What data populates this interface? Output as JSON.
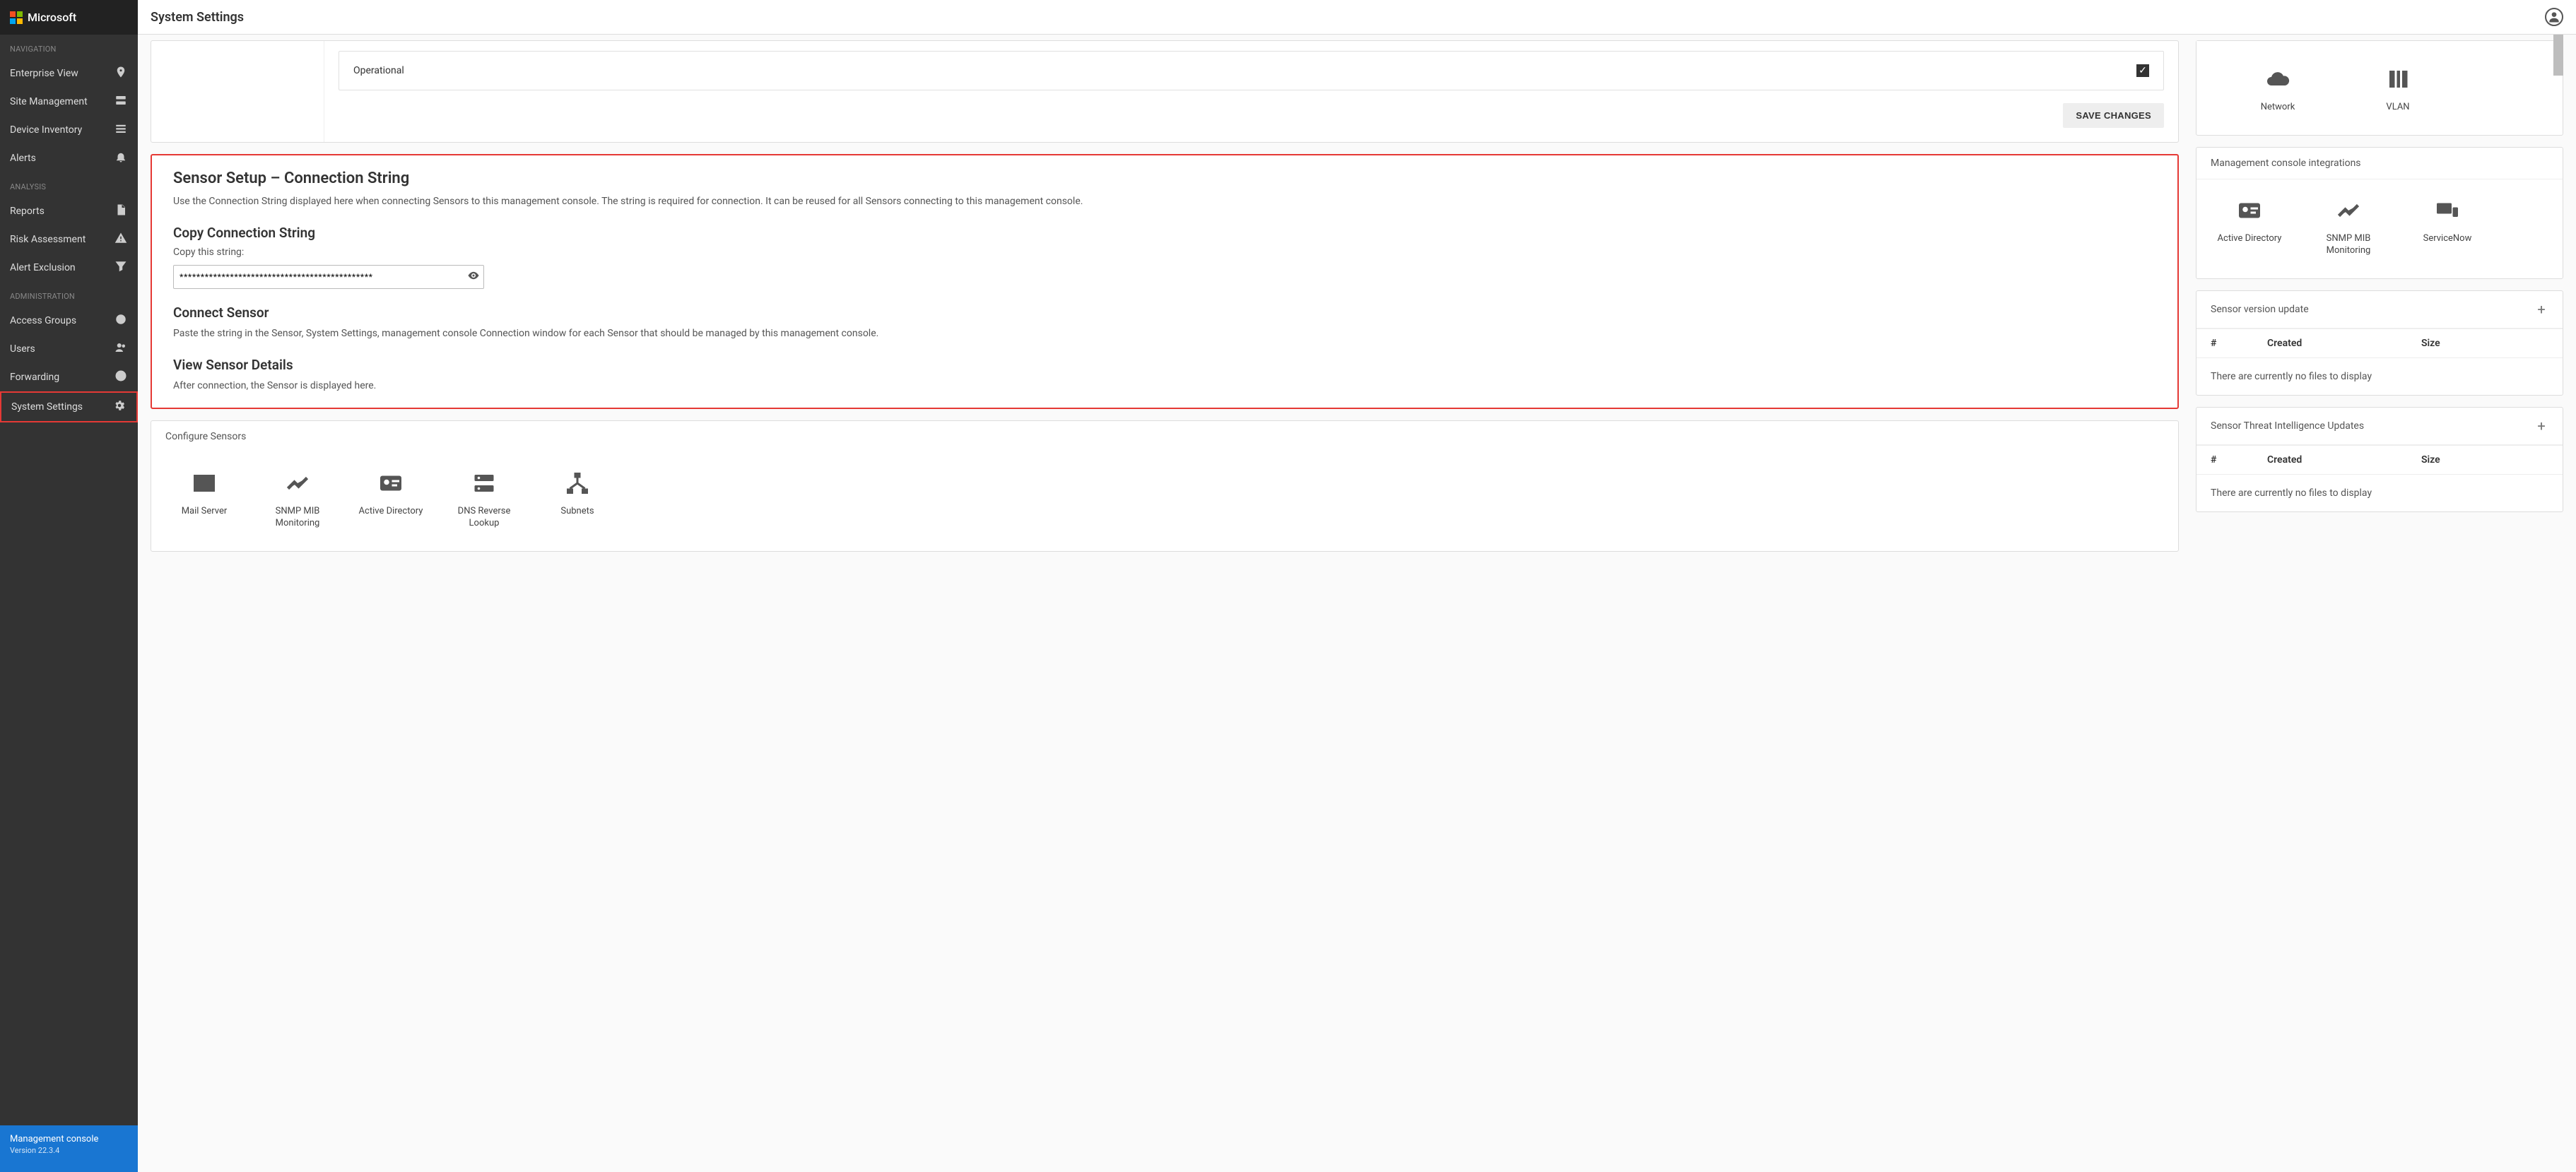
{
  "brand": {
    "name": "Microsoft"
  },
  "topbar": {
    "title": "System Settings"
  },
  "sidebar": {
    "sections": [
      {
        "label": "NAVIGATION",
        "items": [
          {
            "id": "enterprise-view",
            "label": "Enterprise View"
          },
          {
            "id": "site-management",
            "label": "Site Management"
          },
          {
            "id": "device-inventory",
            "label": "Device Inventory"
          },
          {
            "id": "alerts",
            "label": "Alerts"
          }
        ]
      },
      {
        "label": "ANALYSIS",
        "items": [
          {
            "id": "reports",
            "label": "Reports"
          },
          {
            "id": "risk-assessment",
            "label": "Risk Assessment"
          },
          {
            "id": "alert-exclusion",
            "label": "Alert Exclusion"
          }
        ]
      },
      {
        "label": "ADMINISTRATION",
        "items": [
          {
            "id": "access-groups",
            "label": "Access Groups"
          },
          {
            "id": "users",
            "label": "Users"
          },
          {
            "id": "forwarding",
            "label": "Forwarding"
          },
          {
            "id": "system-settings",
            "label": "System Settings",
            "active": true
          }
        ]
      }
    ],
    "footer": {
      "title": "Management console",
      "version": "Version 22.3.4"
    }
  },
  "left": {
    "operational": {
      "label": "Operational",
      "checked": true,
      "save_btn": "SAVE CHANGES"
    },
    "sensor_setup": {
      "title": "Sensor Setup – Connection String",
      "desc": "Use the Connection String displayed here when connecting Sensors to this management console. The string is required for connection. It can be reused for all Sensors connecting to this management console.",
      "copy_title": "Copy Connection String",
      "copy_label": "Copy this string:",
      "conn_string": "**********************************************",
      "connect_title": "Connect Sensor",
      "connect_desc": "Paste the string in the Sensor, System Settings, management console Connection window for each Sensor that should be managed by this management console.",
      "view_title": "View Sensor Details",
      "view_desc": "After connection, the Sensor is displayed here."
    },
    "configure": {
      "header": "Configure Sensors",
      "tiles": [
        {
          "id": "mail-server",
          "label": "Mail Server"
        },
        {
          "id": "snmp-mib",
          "label": "SNMP MIB Monitoring"
        },
        {
          "id": "active-directory",
          "label": "Active Directory"
        },
        {
          "id": "dns-reverse",
          "label": "DNS Reverse Lookup"
        },
        {
          "id": "subnets",
          "label": "Subnets"
        }
      ]
    }
  },
  "right": {
    "network_tiles": [
      {
        "id": "network",
        "label": "Network"
      },
      {
        "id": "vlan",
        "label": "VLAN"
      }
    ],
    "integrations": {
      "header": "Management console integrations",
      "tiles": [
        {
          "id": "active-directory",
          "label": "Active Directory"
        },
        {
          "id": "snmp-mib",
          "label": "SNMP MIB Monitoring"
        },
        {
          "id": "servicenow",
          "label": "ServiceNow"
        }
      ]
    },
    "sensor_version": {
      "header": "Sensor version update",
      "cols": {
        "num": "#",
        "created": "Created",
        "size": "Size"
      },
      "empty": "There are currently no files to display"
    },
    "threat_intel": {
      "header": "Sensor Threat Intelligence Updates",
      "cols": {
        "num": "#",
        "created": "Created",
        "size": "Size"
      },
      "empty": "There are currently no files to display"
    }
  }
}
